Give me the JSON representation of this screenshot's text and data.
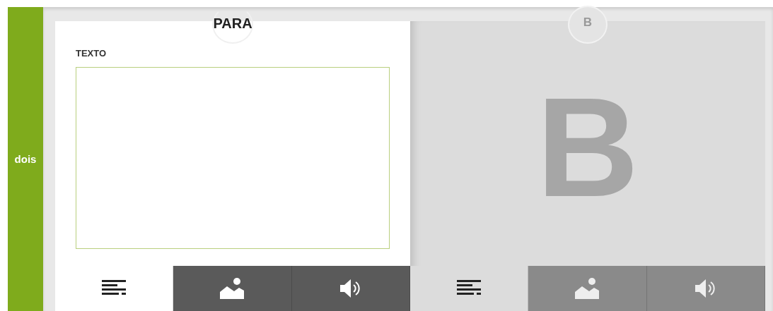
{
  "sidebar": {
    "label": "dois"
  },
  "cards": [
    {
      "kind": "editor",
      "title": "PARA",
      "active": true,
      "field_label": "TEXTO",
      "tabs": [
        {
          "kind": "text",
          "selected": true
        },
        {
          "kind": "image",
          "selected": false
        },
        {
          "kind": "audio",
          "selected": false
        }
      ]
    },
    {
      "kind": "letter",
      "title": "B",
      "active": false,
      "letter": "B",
      "tabs": [
        {
          "kind": "text",
          "selected": true
        },
        {
          "kind": "image",
          "selected": false
        },
        {
          "kind": "audio",
          "selected": false
        }
      ]
    }
  ]
}
